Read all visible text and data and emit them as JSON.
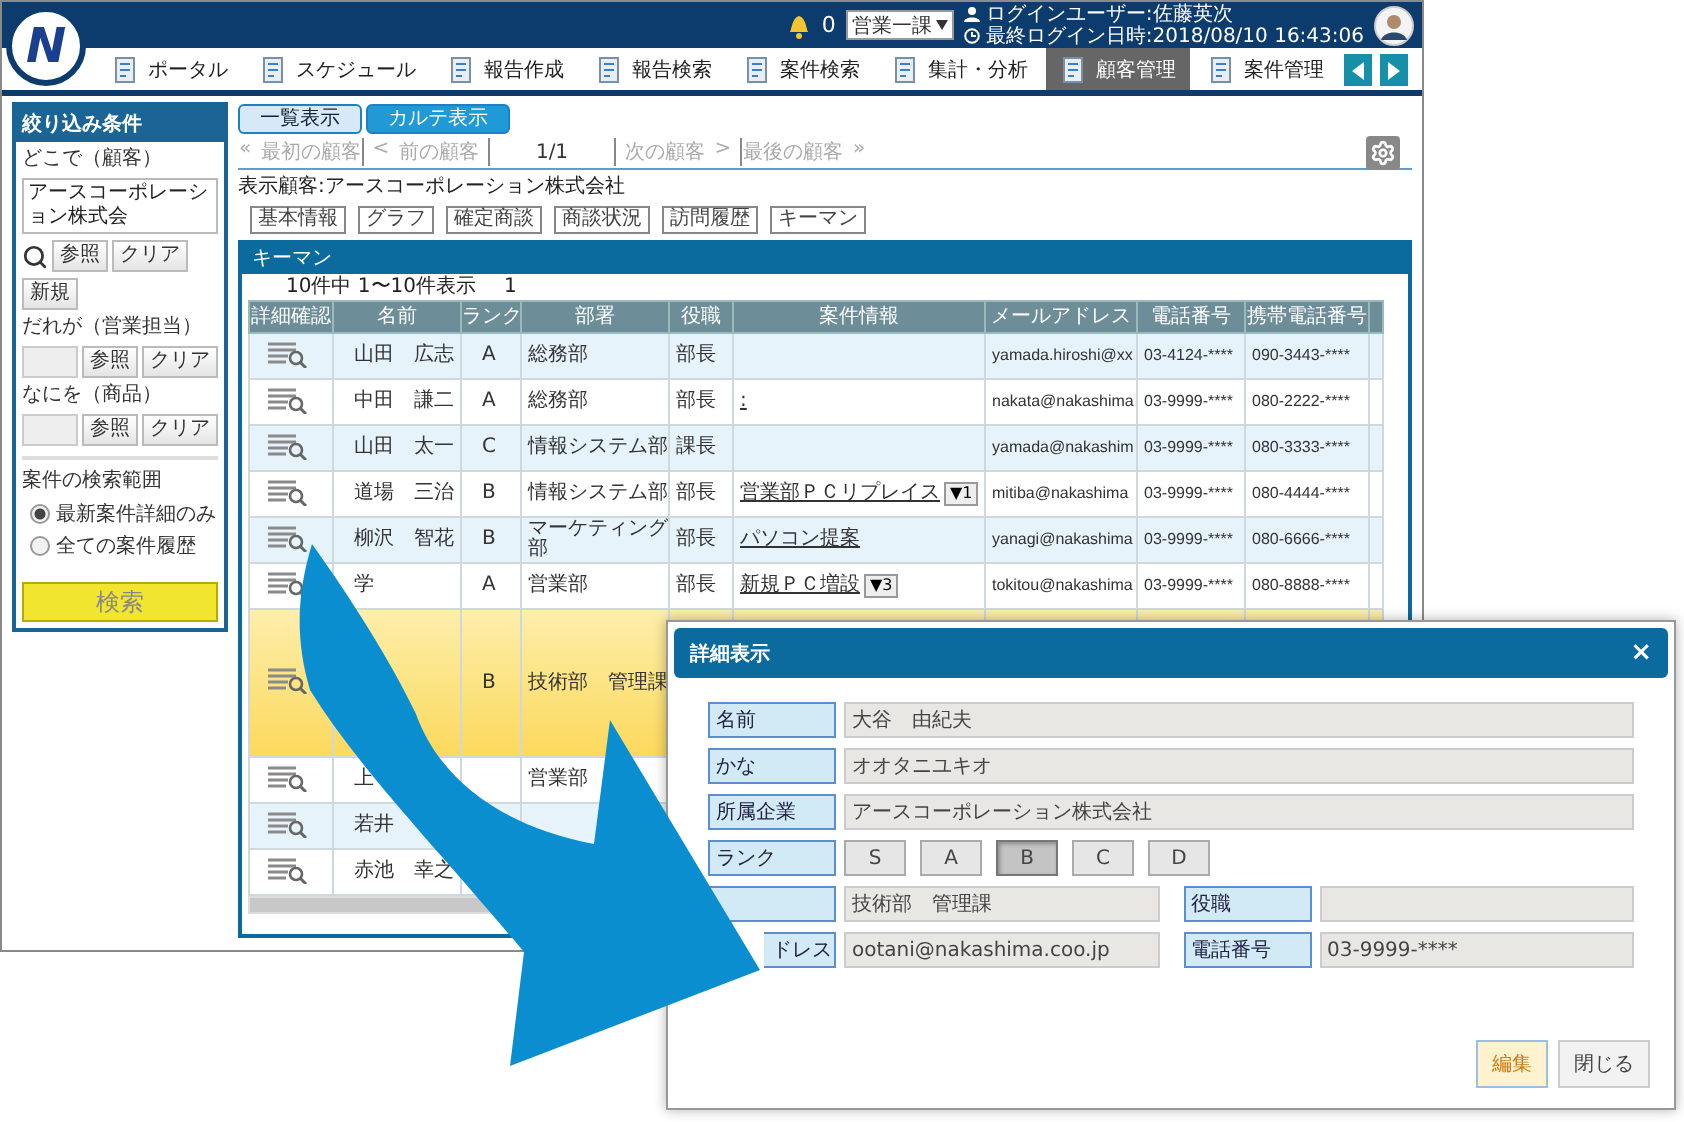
{
  "logo": "N",
  "header": {
    "notification_count": "0",
    "department": "営業一課",
    "login_user": "ログインユーザー:佐藤英次",
    "last_login": "最終ログイン日時:2018/08/10 16:43:06"
  },
  "nav": [
    {
      "label": "ポータル",
      "selected": false
    },
    {
      "label": "スケジュール",
      "selected": false
    },
    {
      "label": "報告作成",
      "selected": false
    },
    {
      "label": "報告検索",
      "selected": false
    },
    {
      "label": "案件検索",
      "selected": false
    },
    {
      "label": "集計・分析",
      "selected": false
    },
    {
      "label": "顧客管理",
      "selected": true
    },
    {
      "label": "案件管理",
      "selected": false
    }
  ],
  "filter": {
    "title": "絞り込み条件",
    "fields": [
      {
        "kind": "customer",
        "label": "どこで（顧客）",
        "value": "アースコーポレーション株式会",
        "buttons": [
          "参照",
          "クリア"
        ],
        "extra_button": "新規"
      },
      {
        "kind": "plain",
        "label": "だれが（営業担当）",
        "buttons": [
          "参照",
          "クリア"
        ]
      },
      {
        "kind": "plain",
        "label": "なにを（商品）",
        "buttons": [
          "参照",
          "クリア"
        ]
      }
    ],
    "scope_label": "案件の検索範囲",
    "scope_options": [
      {
        "label": "最新案件詳細のみ",
        "selected": true
      },
      {
        "label": "全ての案件履歴",
        "selected": false
      }
    ],
    "search_button": "検索"
  },
  "view_tabs": [
    {
      "label": "一覧表示",
      "selected": false
    },
    {
      "label": "カルテ表示",
      "selected": true
    }
  ],
  "pager": [
    {
      "kind": "before",
      "mark": "«",
      "label": "最初の顧客",
      "disabled": true
    },
    {
      "kind": "before",
      "mark": "<",
      "label": "前の顧客",
      "disabled": true
    },
    {
      "kind": "center",
      "label": "1/1",
      "disabled": false
    },
    {
      "kind": "after",
      "mark": ">",
      "label": "次の顧客",
      "disabled": true
    },
    {
      "kind": "after",
      "mark": "»",
      "label": "最後の顧客",
      "disabled": true
    }
  ],
  "customer_line": "表示顧客:アースコーポレーション株式会社",
  "section_buttons": [
    "基本情報",
    "グラフ",
    "確定商談",
    "商談状況",
    "訪問履歴",
    "キーマン"
  ],
  "keyman": {
    "title": "キーマン",
    "count": "10件中 1〜10件表示",
    "page": "1",
    "columns": [
      "詳細確認",
      "名前",
      "ランク",
      "部署",
      "役職",
      "案件情報",
      "メールアドレス",
      "電話番号",
      "携帯電話番号"
    ],
    "rows": [
      {
        "selected": false,
        "name": "山田　広志",
        "rank": "A",
        "dept": "総務部",
        "role": "部長",
        "email": "yamada.hiroshi@xx",
        "phone": "03-4124-****",
        "mobile": "090-3443-****"
      },
      {
        "selected": false,
        "name": "中田　謙二",
        "rank": "A",
        "dept": "総務部",
        "role": "部長",
        "case": ":",
        "email": "nakata@nakashima",
        "phone": "03-9999-****",
        "mobile": "080-2222-****"
      },
      {
        "selected": false,
        "name": "山田　太一",
        "rank": "C",
        "dept": "情報システム部",
        "role": "課長",
        "email": "yamada@nakashim",
        "phone": "03-9999-****",
        "mobile": "080-3333-****"
      },
      {
        "selected": false,
        "name": "道場　三治",
        "rank": "B",
        "dept": "情報システム部",
        "role": "部長",
        "case": "営業部ＰＣリプレイス",
        "case_badge": "▼1",
        "email": "mitiba@nakashima",
        "phone": "03-9999-****",
        "mobile": "080-4444-****"
      },
      {
        "selected": false,
        "name": "柳沢　智花",
        "rank": "B",
        "dept": "マーケティング部",
        "role": "部長",
        "case": "パソコン提案",
        "email": "yanagi@nakashima",
        "phone": "03-9999-****",
        "mobile": "080-6666-****"
      },
      {
        "selected": false,
        "name": "学",
        "rank": "A",
        "dept": "営業部",
        "role": "部長",
        "case": "新規ＰＣ増設",
        "case_badge": "▼3",
        "email": "tokitou@nakashima",
        "phone": "03-9999-****",
        "mobile": "080-8888-****"
      },
      {
        "selected": true,
        "rank": "B",
        "dept": "技術部　管理課"
      },
      {
        "selected": false,
        "name": "上",
        "dept": "営業部"
      },
      {
        "selected": false,
        "name": "若井"
      },
      {
        "selected": false,
        "name": "赤池　幸之"
      }
    ]
  },
  "dialog": {
    "title": "詳細表示",
    "close": "×",
    "rows": [
      {
        "kind": "single",
        "label": "名前",
        "value": "大谷　由紀夫"
      },
      {
        "kind": "single",
        "label": "かな",
        "value": "オオタニユキオ"
      },
      {
        "kind": "single",
        "label": "所属企業",
        "value": "アースコーポレーション株式会社"
      },
      {
        "kind": "rank",
        "label": "ランク",
        "options": [
          {
            "label": "S",
            "selected": false
          },
          {
            "label": "A",
            "selected": false
          },
          {
            "label": "B",
            "selected": true
          },
          {
            "label": "C",
            "selected": false
          },
          {
            "label": "D",
            "selected": false
          }
        ]
      },
      {
        "kind": "pair",
        "items": [
          {
            "value": "技術部　管理課"
          },
          {
            "label": "役職"
          }
        ]
      },
      {
        "kind": "pair",
        "items": [
          {
            "label": "ドレス",
            "cut": true,
            "value": "ootani@nakashima.coo.jp"
          },
          {
            "label": "電話番号",
            "value": "03-9999-****"
          }
        ]
      }
    ],
    "buttons": [
      {
        "label": "編集",
        "primary": true
      },
      {
        "label": "閉じる",
        "primary": false
      }
    ]
  }
}
